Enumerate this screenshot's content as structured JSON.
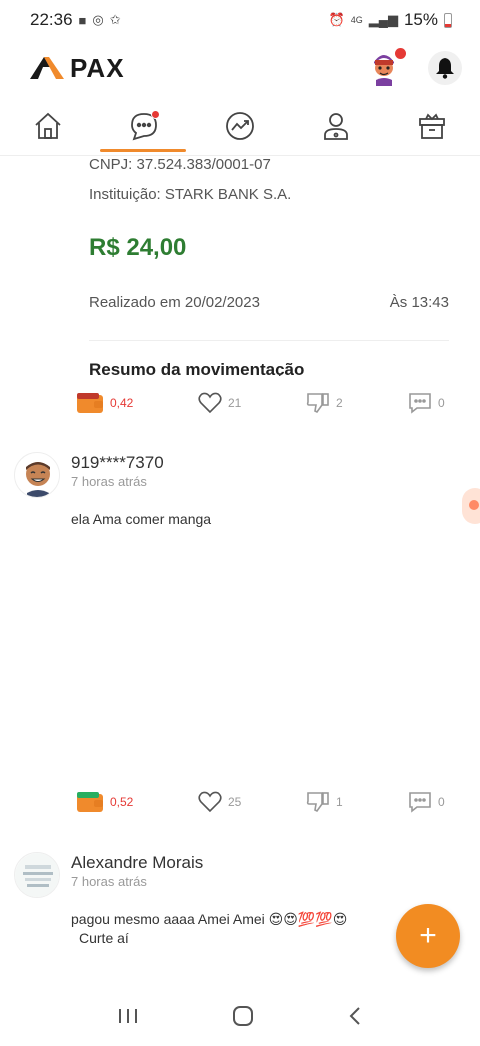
{
  "status_bar": {
    "time": "22:36",
    "battery": "15%",
    "network": "4G"
  },
  "app": {
    "logo_text": "PAX",
    "brand_color": "#f08a2c"
  },
  "nav": {
    "items": [
      {
        "name": "home",
        "icon": "home-icon"
      },
      {
        "name": "chat",
        "icon": "chat-icon",
        "active": true,
        "badge": true
      },
      {
        "name": "trending",
        "icon": "trending-icon"
      },
      {
        "name": "profile",
        "icon": "user-icon"
      },
      {
        "name": "gift",
        "icon": "gift-icon"
      }
    ]
  },
  "receipt": {
    "cnpj": "CNPJ: 37.524.383/0001-07",
    "institution": "Instituição: STARK BANK S.A.",
    "amount": "R$ 24,00",
    "date": "Realizado em 20/02/2023",
    "time": "Às 13:43",
    "section_title": "Resumo da movimentação"
  },
  "posts": [
    {
      "wallet_value": "0,42",
      "likes": "21",
      "dislikes": "2",
      "comments": "0"
    },
    {
      "user": "919****7370",
      "time": "7 horas atrás",
      "text": "ela Ama comer manga",
      "wallet_value": "0,52",
      "likes": "25",
      "dislikes": "1",
      "comments": "0"
    },
    {
      "user": "Alexandre Morais",
      "time": "7 horas atrás",
      "text_line1": "pagou mesmo aaaa Amei Amei 😍😍💯💯😍",
      "text_line2": "Curte aí"
    }
  ],
  "fab": {
    "label": "+"
  },
  "colors": {
    "amount_green": "#2e7d32",
    "wallet_red": "#e53935",
    "accent_orange": "#f28c22"
  }
}
